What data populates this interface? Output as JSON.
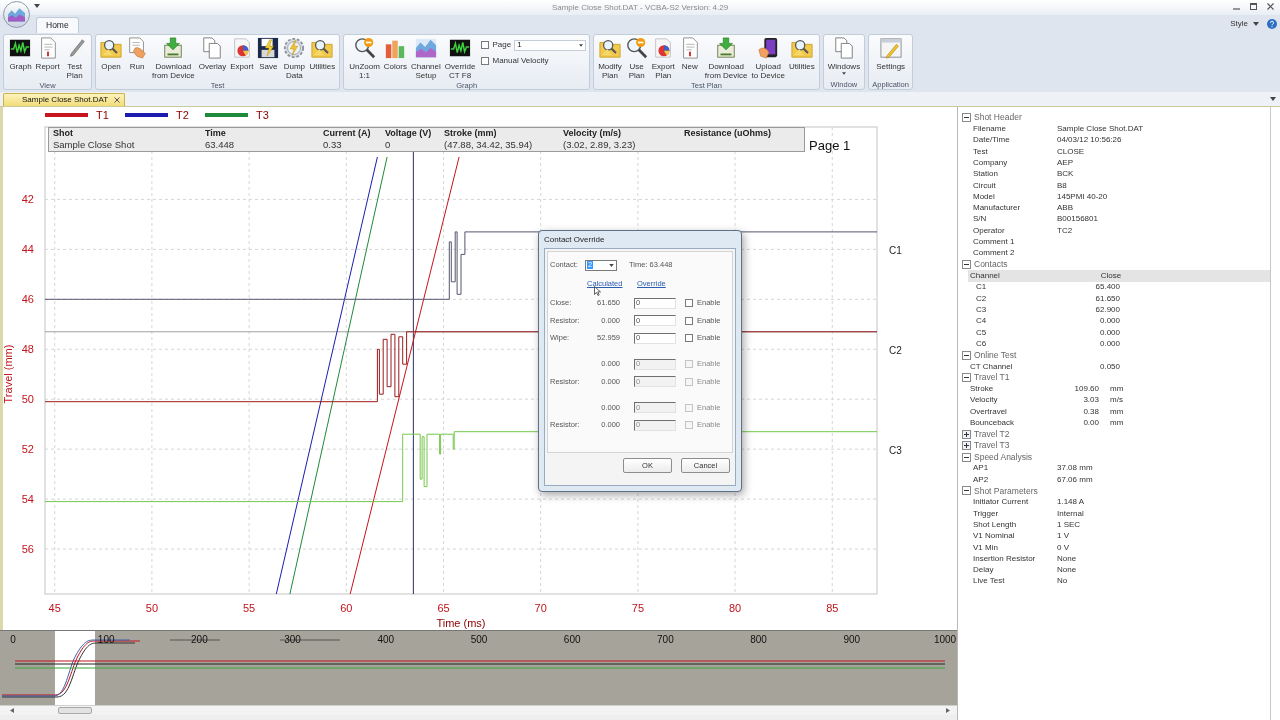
{
  "window": {
    "title": "Sample Close Shot.DAT - VCBA-S2 Version: 4.29"
  },
  "tabs": [
    {
      "label": "Home",
      "selected": true
    }
  ],
  "style_menu": {
    "label": "Style"
  },
  "ribbon": {
    "groups": [
      {
        "label": "View",
        "buttons": [
          {
            "label": "Graph"
          },
          {
            "label": "Report"
          },
          {
            "label": "Test\nPlan"
          }
        ]
      },
      {
        "label": "Test",
        "buttons": [
          {
            "label": "Open"
          },
          {
            "label": "Run"
          },
          {
            "label": "Download\nfrom Device"
          },
          {
            "label": "Overlay"
          },
          {
            "label": "Export"
          },
          {
            "label": "Save"
          },
          {
            "label": "Dump\nData"
          },
          {
            "label": "Utilities"
          }
        ]
      },
      {
        "label": "Graph",
        "buttons": [
          {
            "label": "UnZoom\n1:1"
          },
          {
            "label": "Colors"
          },
          {
            "label": "Channel\nSetup"
          },
          {
            "label": "Override\nCT F8"
          }
        ],
        "options": {
          "page": {
            "label": "Page",
            "checked": false,
            "value": "1"
          },
          "manual_velocity": {
            "label": "Manual Velocity",
            "checked": false
          }
        }
      },
      {
        "label": "Test Plan",
        "buttons": [
          {
            "label": "Modify\nPlan"
          },
          {
            "label": "Use\nPlan"
          },
          {
            "label": "Export\nPlan"
          },
          {
            "label": "New"
          },
          {
            "label": "Download\nfrom Device"
          },
          {
            "label": "Upload\nto Device"
          },
          {
            "label": "Utilities"
          }
        ]
      },
      {
        "label": "Window",
        "buttons": [
          {
            "label": "Windows",
            "kind": "menu"
          }
        ]
      },
      {
        "label": "Application",
        "buttons": [
          {
            "label": "Settings"
          }
        ]
      }
    ]
  },
  "document_tabs": [
    {
      "label": "Sample Close Shot.DAT",
      "selected": true
    }
  ],
  "graph": {
    "header_table": {
      "columns": [
        "Shot",
        "Time",
        "Current (A)",
        "Voltage (V)",
        "Stroke (mm)",
        "Velocity (m/s)",
        "Resistance (uOhms)"
      ],
      "rows": [
        [
          "Sample Close Shot",
          "63.448",
          "0.33",
          "0",
          "(47.88, 34.42, 35.94)",
          "(3.02, 2.89, 3.23)"
        ]
      ]
    },
    "page_label": "Page 1",
    "chart_data": [
      {
        "type": "line",
        "xlabel": "Time (ms)",
        "ylabel": "Travel (mm)",
        "xlim": [
          44.5,
          87.3
        ],
        "ylim": [
          57.8,
          39.1
        ],
        "xticks": [
          45,
          50,
          55,
          60,
          65,
          70,
          75,
          80,
          85
        ],
        "yticks": [
          42,
          44,
          46,
          48,
          50,
          52,
          54,
          56
        ],
        "grid": true,
        "legend": "top",
        "series": [
          {
            "name": "T1",
            "color": "#c8141e",
            "x": [
              60.2,
              65.8
            ],
            "values": [
              57.8,
              40.3
            ]
          },
          {
            "name": "T2",
            "color": "#1c1cb0",
            "x": [
              56.4,
              61.6
            ],
            "values": [
              57.8,
              40.3
            ]
          },
          {
            "name": "T3",
            "color": "#1e8a3c",
            "x": [
              57.1,
              62.1
            ],
            "values": [
              57.8,
              40.3
            ]
          },
          {
            "name": "C1",
            "type": "step",
            "color": "#55556e",
            "x": [
              44.5,
              65.3,
              65.4,
              65.6,
              65.7,
              65.9,
              66.1,
              66.3,
              87.3
            ],
            "values": [
              46.0,
              43.7,
              45.3,
              43.3,
              45.8,
              44.2,
              43.3,
              43.3,
              43.3
            ]
          },
          {
            "name": "C2",
            "type": "step",
            "color": "#9b1b1b",
            "x": [
              44.5,
              61.6,
              61.7,
              61.9,
              62.1,
              62.3,
              62.5,
              62.7,
              62.9,
              63.1,
              63.3,
              87.3
            ],
            "values": [
              50.1,
              48.0,
              49.8,
              47.6,
              49.5,
              47.4,
              49.9,
              47.5,
              48.6,
              47.3,
              47.3,
              47.3
            ]
          },
          {
            "name": "C3",
            "type": "step",
            "color": "#74c84c",
            "x": [
              44.5,
              62.9,
              63.8,
              63.9,
              64.0,
              64.15,
              64.3,
              64.8,
              64.85,
              65.0,
              65.5,
              65.55,
              65.7,
              87.3
            ],
            "values": [
              54.1,
              51.4,
              53.2,
              51.5,
              53.5,
              51.4,
              51.4,
              52.2,
              51.4,
              51.4,
              52.0,
              51.3,
              51.3,
              51.3
            ]
          }
        ],
        "ref_lines": [
          {
            "axis": "x",
            "value": 63.45,
            "color": "#2e2e5e"
          },
          {
            "axis": "y",
            "value": 47.3,
            "color": "#a0a0a0"
          }
        ]
      }
    ]
  },
  "overview": {
    "ticks": [
      "0",
      "100",
      "200",
      "300",
      "400",
      "500",
      "600",
      "700",
      "800",
      "900",
      "1000"
    ]
  },
  "dialog": {
    "title": "Contact Override",
    "contact_label": "Contact:",
    "contact_value": "2",
    "time": "Time: 63.448",
    "column_links": [
      "Calculated",
      "Override"
    ],
    "groups": [
      [
        {
          "label": "Close:",
          "calculated": "61.650",
          "value": "0",
          "enable": "Enable",
          "checked": false,
          "disabled": false
        },
        {
          "label": "Resistor:",
          "calculated": "0.000",
          "value": "0",
          "enable": "Enable",
          "checked": false,
          "disabled": false
        },
        {
          "label": "Wipe:",
          "calculated": "52.959",
          "value": "0",
          "enable": "Enable",
          "checked": false,
          "disabled": false
        }
      ],
      [
        {
          "calculated": "0.000",
          "value": "0",
          "enable": "Enable",
          "checked": false,
          "disabled": true
        },
        {
          "label": "Resistor:",
          "calculated": "0.000",
          "value": "0",
          "enable": "Enable",
          "checked": false,
          "disabled": true
        }
      ],
      [
        {
          "calculated": "0.000",
          "value": "0",
          "enable": "Enable",
          "checked": false,
          "disabled": true
        },
        {
          "label": "Resistor:",
          "calculated": "0.000",
          "value": "0",
          "enable": "Enable",
          "checked": false,
          "disabled": true
        }
      ]
    ],
    "buttons": [
      "OK",
      "Cancel"
    ]
  },
  "properties": {
    "sections": [
      {
        "title": "Shot Header",
        "expanded": true,
        "kind": "fields",
        "rows": [
          {
            "label": "Filename",
            "value": "Sample Close Shot.DAT"
          },
          {
            "label": "Date/Time",
            "value": "04/03/12 10:56:26"
          },
          {
            "label": "Test",
            "value": "CLOSE"
          },
          {
            "label": "Company",
            "value": "AEP"
          },
          {
            "label": "Station",
            "value": "BCK"
          },
          {
            "label": "Circuit",
            "value": "B8"
          },
          {
            "label": "Model",
            "value": "145PMI 40-20"
          },
          {
            "label": "Manufacturer",
            "value": "ABB"
          },
          {
            "label": "S/N",
            "value": "B00156801"
          },
          {
            "label": "Operator",
            "value": "TC2"
          },
          {
            "label": "Comment 1"
          },
          {
            "label": "Comment 2"
          }
        ]
      },
      {
        "title": "Contacts",
        "expanded": true,
        "kind": "grid",
        "columns": [
          "Channel",
          "Close"
        ],
        "rows": [
          {
            "label": "C1",
            "value": "65.400"
          },
          {
            "label": "C2",
            "value": "61.650"
          },
          {
            "label": "C3",
            "value": "62.900"
          },
          {
            "label": "C4",
            "value": "0.000"
          },
          {
            "label": "C5",
            "value": "0.000"
          },
          {
            "label": "C6",
            "value": "0.000"
          }
        ]
      },
      {
        "title": "Online Test",
        "expanded": true,
        "kind": "grid",
        "rows": [
          {
            "label": "CT Channel",
            "value": "0.050"
          }
        ]
      },
      {
        "title": "Travel T1",
        "expanded": true,
        "kind": "measures",
        "rows": [
          {
            "label": "Stroke",
            "value": "109.60",
            "unit": "mm"
          },
          {
            "label": "Velocity",
            "value": "3.03",
            "unit": "m/s"
          },
          {
            "label": "Overtravel",
            "value": "0.38",
            "unit": "mm"
          },
          {
            "label": "Bounceback",
            "value": "0.00",
            "unit": "mm"
          }
        ]
      },
      {
        "title": "Travel T2",
        "expanded": false
      },
      {
        "title": "Travel T3",
        "expanded": false
      },
      {
        "title": "Speed Analysis",
        "expanded": true,
        "kind": "fields",
        "rows": [
          {
            "label": "AP1",
            "value": "37.08 mm"
          },
          {
            "label": "AP2",
            "value": "67.06 mm"
          }
        ]
      },
      {
        "title": "Shot Parameters",
        "expanded": true,
        "kind": "fields",
        "rows": [
          {
            "label": "Initiator Current",
            "value": "1.148 A"
          },
          {
            "label": "Trigger",
            "value": "Internal"
          },
          {
            "label": "Shot Length",
            "value": "1 SEC"
          },
          {
            "label": "V1 Nominal",
            "value": "1 V"
          },
          {
            "label": "V1 Min",
            "value": "0 V"
          },
          {
            "label": "Insertion Resistor",
            "value": "None"
          },
          {
            "label": "Delay",
            "value": "None"
          },
          {
            "label": "Live Test",
            "value": "No"
          }
        ]
      }
    ]
  }
}
